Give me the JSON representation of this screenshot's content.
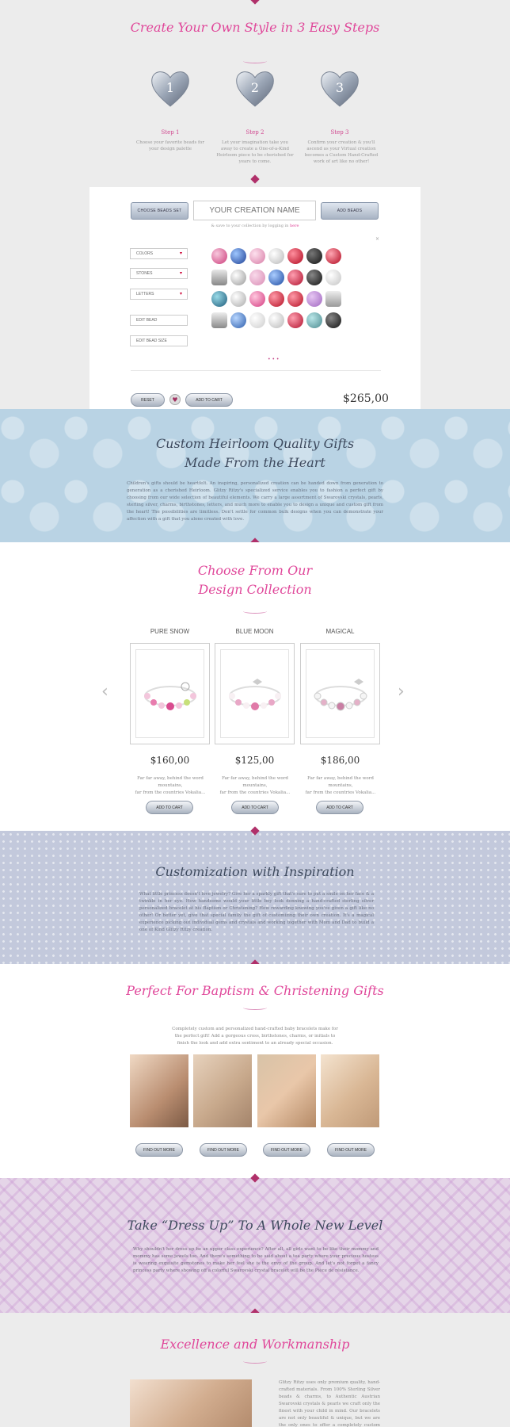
{
  "steps_section": {
    "title": "Create Your Own Style in 3 Easy Steps",
    "steps": [
      {
        "number": "1",
        "title": "Step 1",
        "text": "Choose your favorite beads for your design palette"
      },
      {
        "number": "2",
        "title": "Step 2",
        "text": "Let your imagination take you away to create a One-of-a-Kind Heirloom piece to be cherished for years to come."
      },
      {
        "number": "3",
        "title": "Step 3",
        "text": "Confirm your creation & you'll ascend as your Virtual creation becomes a Custom Hand-Crafted work of art like no other!"
      }
    ]
  },
  "builder": {
    "choose_beads_label": "CHOOSE BEADS SET",
    "creation_name_placeholder": "YOUR CREATION NAME",
    "add_beads_label": "ADD BEADS",
    "login_note": "& save to your collection by logging in",
    "login_link": "here",
    "dropdowns": [
      "COLORS",
      "STONES",
      "LETTERS"
    ],
    "edit_bead_label": "EDIT BEAD",
    "edit_bead_size_label": "EDIT BEAD SIZE",
    "reset_label": "RESET",
    "add_to_cart_label": "ADD TO CART",
    "price": "$265,00",
    "colors": {
      "pink": "#e0479a",
      "steel": "#a9b4c4"
    }
  },
  "heirloom_section": {
    "title_line1": "Custom Heirloom Quality Gifts",
    "title_line2": "Made From the Heart",
    "body": "Children's gifts should be heartfelt. An inspiring, personalized creation can be handed down from generation to generation as a cherished Heirloom. Glitzy Ritzy's specialized service enables you to fashion a perfect gift by choosing from our wide selection of beautiful elements. We carry a large assortment of Swarovski crystals, pearls, sterling silver, charms, birthstones, letters, and much more to enable you to design a unique and custom gift from the heart! The possibilities are limitless. Don't settle for common bulk designs when you can demonstrate your affection with a gift that you alone created with love."
  },
  "collection_section": {
    "title_line1": "Choose From Our",
    "title_line2": "Design Collection",
    "products": [
      {
        "name": "PURE SNOW",
        "price": "$160,00",
        "desc_line1": "Far far away, behind the word mountains,",
        "desc_line2": "far from the countries Vokalia...",
        "button": "ADD TO CART"
      },
      {
        "name": "BLUE MOON",
        "price": "$125,00",
        "desc_line1": "Far far away, behind the word mountains,",
        "desc_line2": "far from the countries Vokalia...",
        "button": "ADD TO CART"
      },
      {
        "name": "MAGICAL",
        "price": "$186,00",
        "desc_line1": "Far far away, behind the word mountains,",
        "desc_line2": "far from the countries Vokalia...",
        "button": "ADD TO CART"
      }
    ]
  },
  "inspiration_section": {
    "title": "Customization with Inspiration",
    "body": "What little princess doesn't love jewelry? Give her a sparkly gift that's sure to put a smile on her face & a twinkle in her eye. How handsome would your little boy look donning a hand-crafted sterling silver personalized bracelet at his Baptism or Christening? How rewarding knowing you've given a gift like no other! Or better yet, give that special family the gift of customizing their own creation. It's a magical experience picking out individual gems and crystals and working together with Mom and Dad to build a one of Kind Glitzy Ritzy creation."
  },
  "baptism_section": {
    "title": "Perfect For Baptism & Christening Gifts",
    "body": "Completely custom and personalized hand-crafted baby bracelets make for the perfect gift! Add a gorgeous cross, birthstones, charms, or initials to finish the look and add extra sentiment to an already special occasion.",
    "buttons": [
      "FIND OUT MORE",
      "FIND OUT MORE",
      "FIND OUT MORE",
      "FIND OUT MORE"
    ]
  },
  "dressup_section": {
    "title": "Take “Dress Up” To A Whole New Level",
    "body": "Why shouldn't her dress up be an upper class experience? After all, all girls want to be like their mommy and mommy has some jewels too. And there's something to be said about a tea party where your precious hostess is wearing exquisite gemstones to make her feel she is the envy of the group. And let's not forget a fancy princess party where showing off a colorful Swarovski crystal bracelet will be the Pièce de résistance."
  },
  "workmanship_section": {
    "title": "Excellence and Workmanship",
    "body": "Glitzy Ritzy uses only premium quality, hand-crafted materials. From 100% Sterling Silver beads & charms, to Authentic Austrian Swarovski crystals & pearls we craft only the finest with your child in mind. Our bracelets are not only beautiful & unique, but we are the only ones to offer a completely custom virtual platform to create one-of-a-kind gifts. Our jewelry is"
  }
}
